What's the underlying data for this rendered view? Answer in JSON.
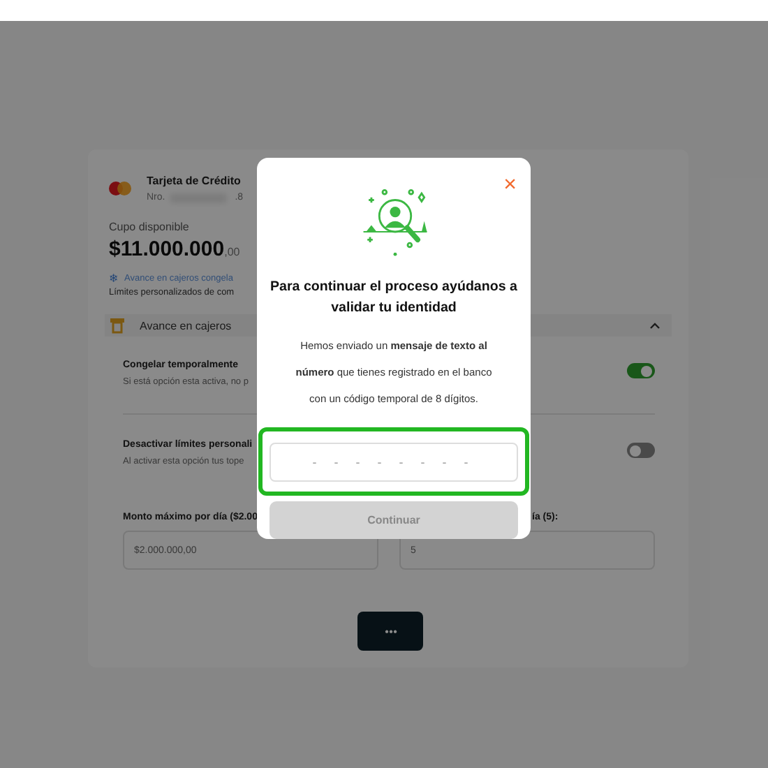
{
  "card": {
    "title": "Tarjeta de Crédito",
    "number_label": "Nro.",
    "number_end": ".8",
    "balance_label": "Cupo disponible",
    "balance": "$11.000.000",
    "balance_cents": ",00",
    "notice_icon": "❄",
    "notice": "Avance en cajeros congela",
    "limits_note": "Límites personalizados de com"
  },
  "section": {
    "title": "Avance en cajeros",
    "expanded": true
  },
  "options": [
    {
      "title": "Congelar temporalmente",
      "description": "Si está opción esta activa, no p",
      "on": true
    },
    {
      "title": "Desactivar límites personali",
      "description": "Al activar esta opción tus tope",
      "on": false
    }
  ],
  "fields": [
    {
      "label": "Monto máximo por día ($2.00",
      "value": "$2.000.000,00"
    },
    {
      "label": "ía (5):",
      "value": "5"
    }
  ],
  "more_button": {
    "label": "• • •"
  },
  "modal": {
    "close": "×",
    "title": "Para continuar el proceso ayúdanos a validar tu identidad",
    "body": "Hemos enviado un **mensaje de texto al número** que tienes registrado en el banco con un código temporal de 8 dígitos.",
    "code_field": {
      "placeholder": "- - - - - - - -",
      "focused": true
    },
    "button": {
      "label": "Continuar",
      "disabled": true
    }
  }
}
